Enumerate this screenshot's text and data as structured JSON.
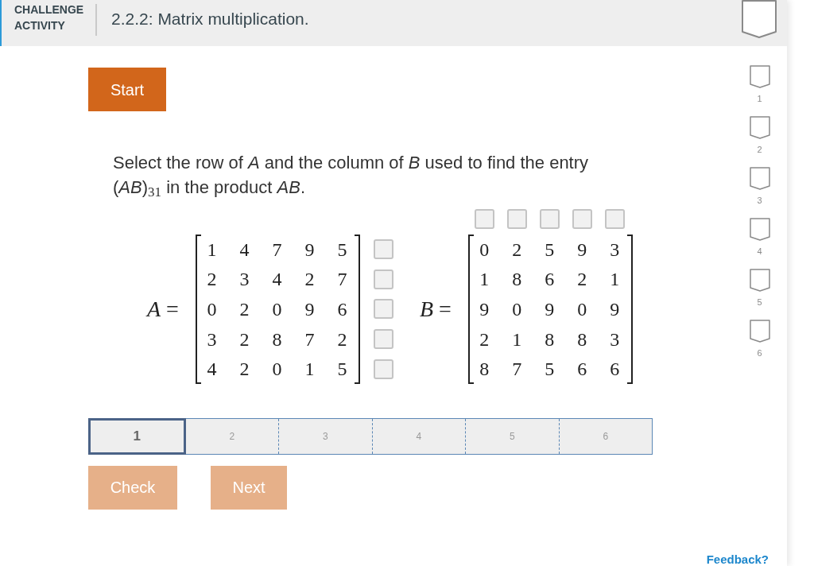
{
  "header": {
    "type_label": "CHALLENGE ACTIVITY",
    "title": "2.2.2: Matrix multiplication.",
    "completed": false
  },
  "start_button": {
    "label": "Start",
    "disabled": false
  },
  "prompt": "Select the row of *A* and the column of *B* used to find the entry (*AB*)$_{31}$ in the product *AB*.",
  "matrices": [
    {
      "label": "*A* =",
      "kind": "rows",
      "rows": [
        [
          "1",
          "4",
          "7",
          "9",
          "5"
        ],
        [
          "2",
          "3",
          "4",
          "2",
          "7"
        ],
        [
          "0",
          "2",
          "0",
          "9",
          "6"
        ],
        [
          "3",
          "2",
          "8",
          "7",
          "2"
        ],
        [
          "4",
          "2",
          "0",
          "1",
          "5"
        ]
      ],
      "selectors": [
        {
          "checked": false
        },
        {
          "checked": false
        },
        {
          "checked": false
        },
        {
          "checked": false
        },
        {
          "checked": false
        }
      ]
    },
    {
      "label": "*B* =",
      "kind": "columns",
      "rows": [
        [
          "0",
          "2",
          "5",
          "9",
          "3"
        ],
        [
          "1",
          "8",
          "6",
          "2",
          "1"
        ],
        [
          "9",
          "0",
          "9",
          "0",
          "9"
        ],
        [
          "2",
          "1",
          "8",
          "8",
          "3"
        ],
        [
          "8",
          "7",
          "5",
          "6",
          "6"
        ]
      ],
      "selectors": [
        {
          "checked": false
        },
        {
          "checked": false
        },
        {
          "checked": false
        },
        {
          "checked": false
        },
        {
          "checked": false
        }
      ]
    }
  ],
  "levels": [
    {
      "label": "1",
      "selected": true
    },
    {
      "label": "2",
      "selected": false
    },
    {
      "label": "3",
      "selected": false
    },
    {
      "label": "4",
      "selected": false
    },
    {
      "label": "5",
      "selected": false
    },
    {
      "label": "6",
      "selected": false
    }
  ],
  "check_button": {
    "label": "Check",
    "disabled": true
  },
  "next_button": {
    "label": "Next",
    "disabled": true
  },
  "questions": [
    {
      "label": "1",
      "completed": false
    },
    {
      "label": "2",
      "completed": false
    },
    {
      "label": "3",
      "completed": false
    },
    {
      "label": "4",
      "completed": false
    },
    {
      "label": "5",
      "completed": false
    },
    {
      "label": "6",
      "completed": false
    }
  ],
  "feedback_link": "Feedback?"
}
